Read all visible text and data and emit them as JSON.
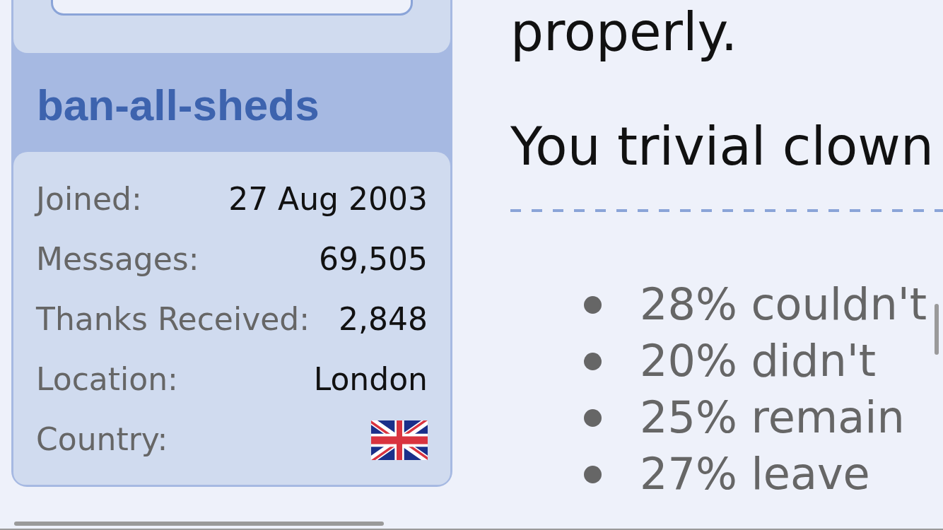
{
  "profile": {
    "username": "ban-all-sheds",
    "details": [
      {
        "kind": "text",
        "label": "Joined:",
        "value": "27 Aug 2003"
      },
      {
        "kind": "text",
        "label": "Messages:",
        "value": "69,505"
      },
      {
        "kind": "text",
        "label": "Thanks Received:",
        "value": "2,848"
      },
      {
        "kind": "text",
        "label": "Location:",
        "value": "London"
      },
      {
        "kind": "flag",
        "label": "Country:"
      }
    ]
  },
  "post": {
    "lines": [
      "properly.",
      "You trivial clown"
    ]
  },
  "signature": {
    "items": [
      "28% couldn't",
      "20% didn't",
      "25% remain",
      "27% leave"
    ]
  }
}
